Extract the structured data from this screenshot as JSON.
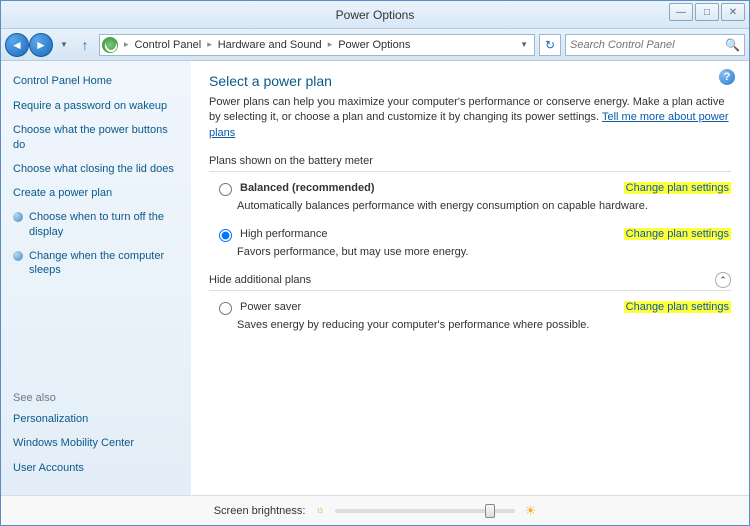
{
  "window": {
    "title": "Power Options"
  },
  "breadcrumbs": [
    "Control Panel",
    "Hardware and Sound",
    "Power Options"
  ],
  "search": {
    "placeholder": "Search Control Panel"
  },
  "sidebar": {
    "home": "Control Panel Home",
    "links": [
      "Require a password on wakeup",
      "Choose what the power buttons do",
      "Choose what closing the lid does",
      "Create a power plan",
      "Choose when to turn off the display",
      "Change when the computer sleeps"
    ],
    "seeAlsoTitle": "See also",
    "seeAlso": [
      "Personalization",
      "Windows Mobility Center",
      "User Accounts"
    ]
  },
  "main": {
    "title": "Select a power plan",
    "intro_part1": "Power plans can help you maximize your computer's performance or conserve energy. Make a plan active by selecting it, or choose a plan and customize it by changing its power settings. ",
    "intro_link": "Tell me more about power plans",
    "section1": "Plans shown on the battery meter",
    "section2": "Hide additional plans",
    "changeLabel": "Change plan settings",
    "plans": [
      {
        "name": "Balanced (recommended)",
        "desc": "Automatically balances performance with energy consumption on capable hardware.",
        "selected": false,
        "bold": true
      },
      {
        "name": "High performance",
        "desc": "Favors performance, but may use more energy.",
        "selected": true,
        "bold": false
      }
    ],
    "extraPlan": {
      "name": "Power saver",
      "desc": "Saves energy by reducing your computer's performance where possible."
    }
  },
  "footer": {
    "label": "Screen brightness:"
  }
}
